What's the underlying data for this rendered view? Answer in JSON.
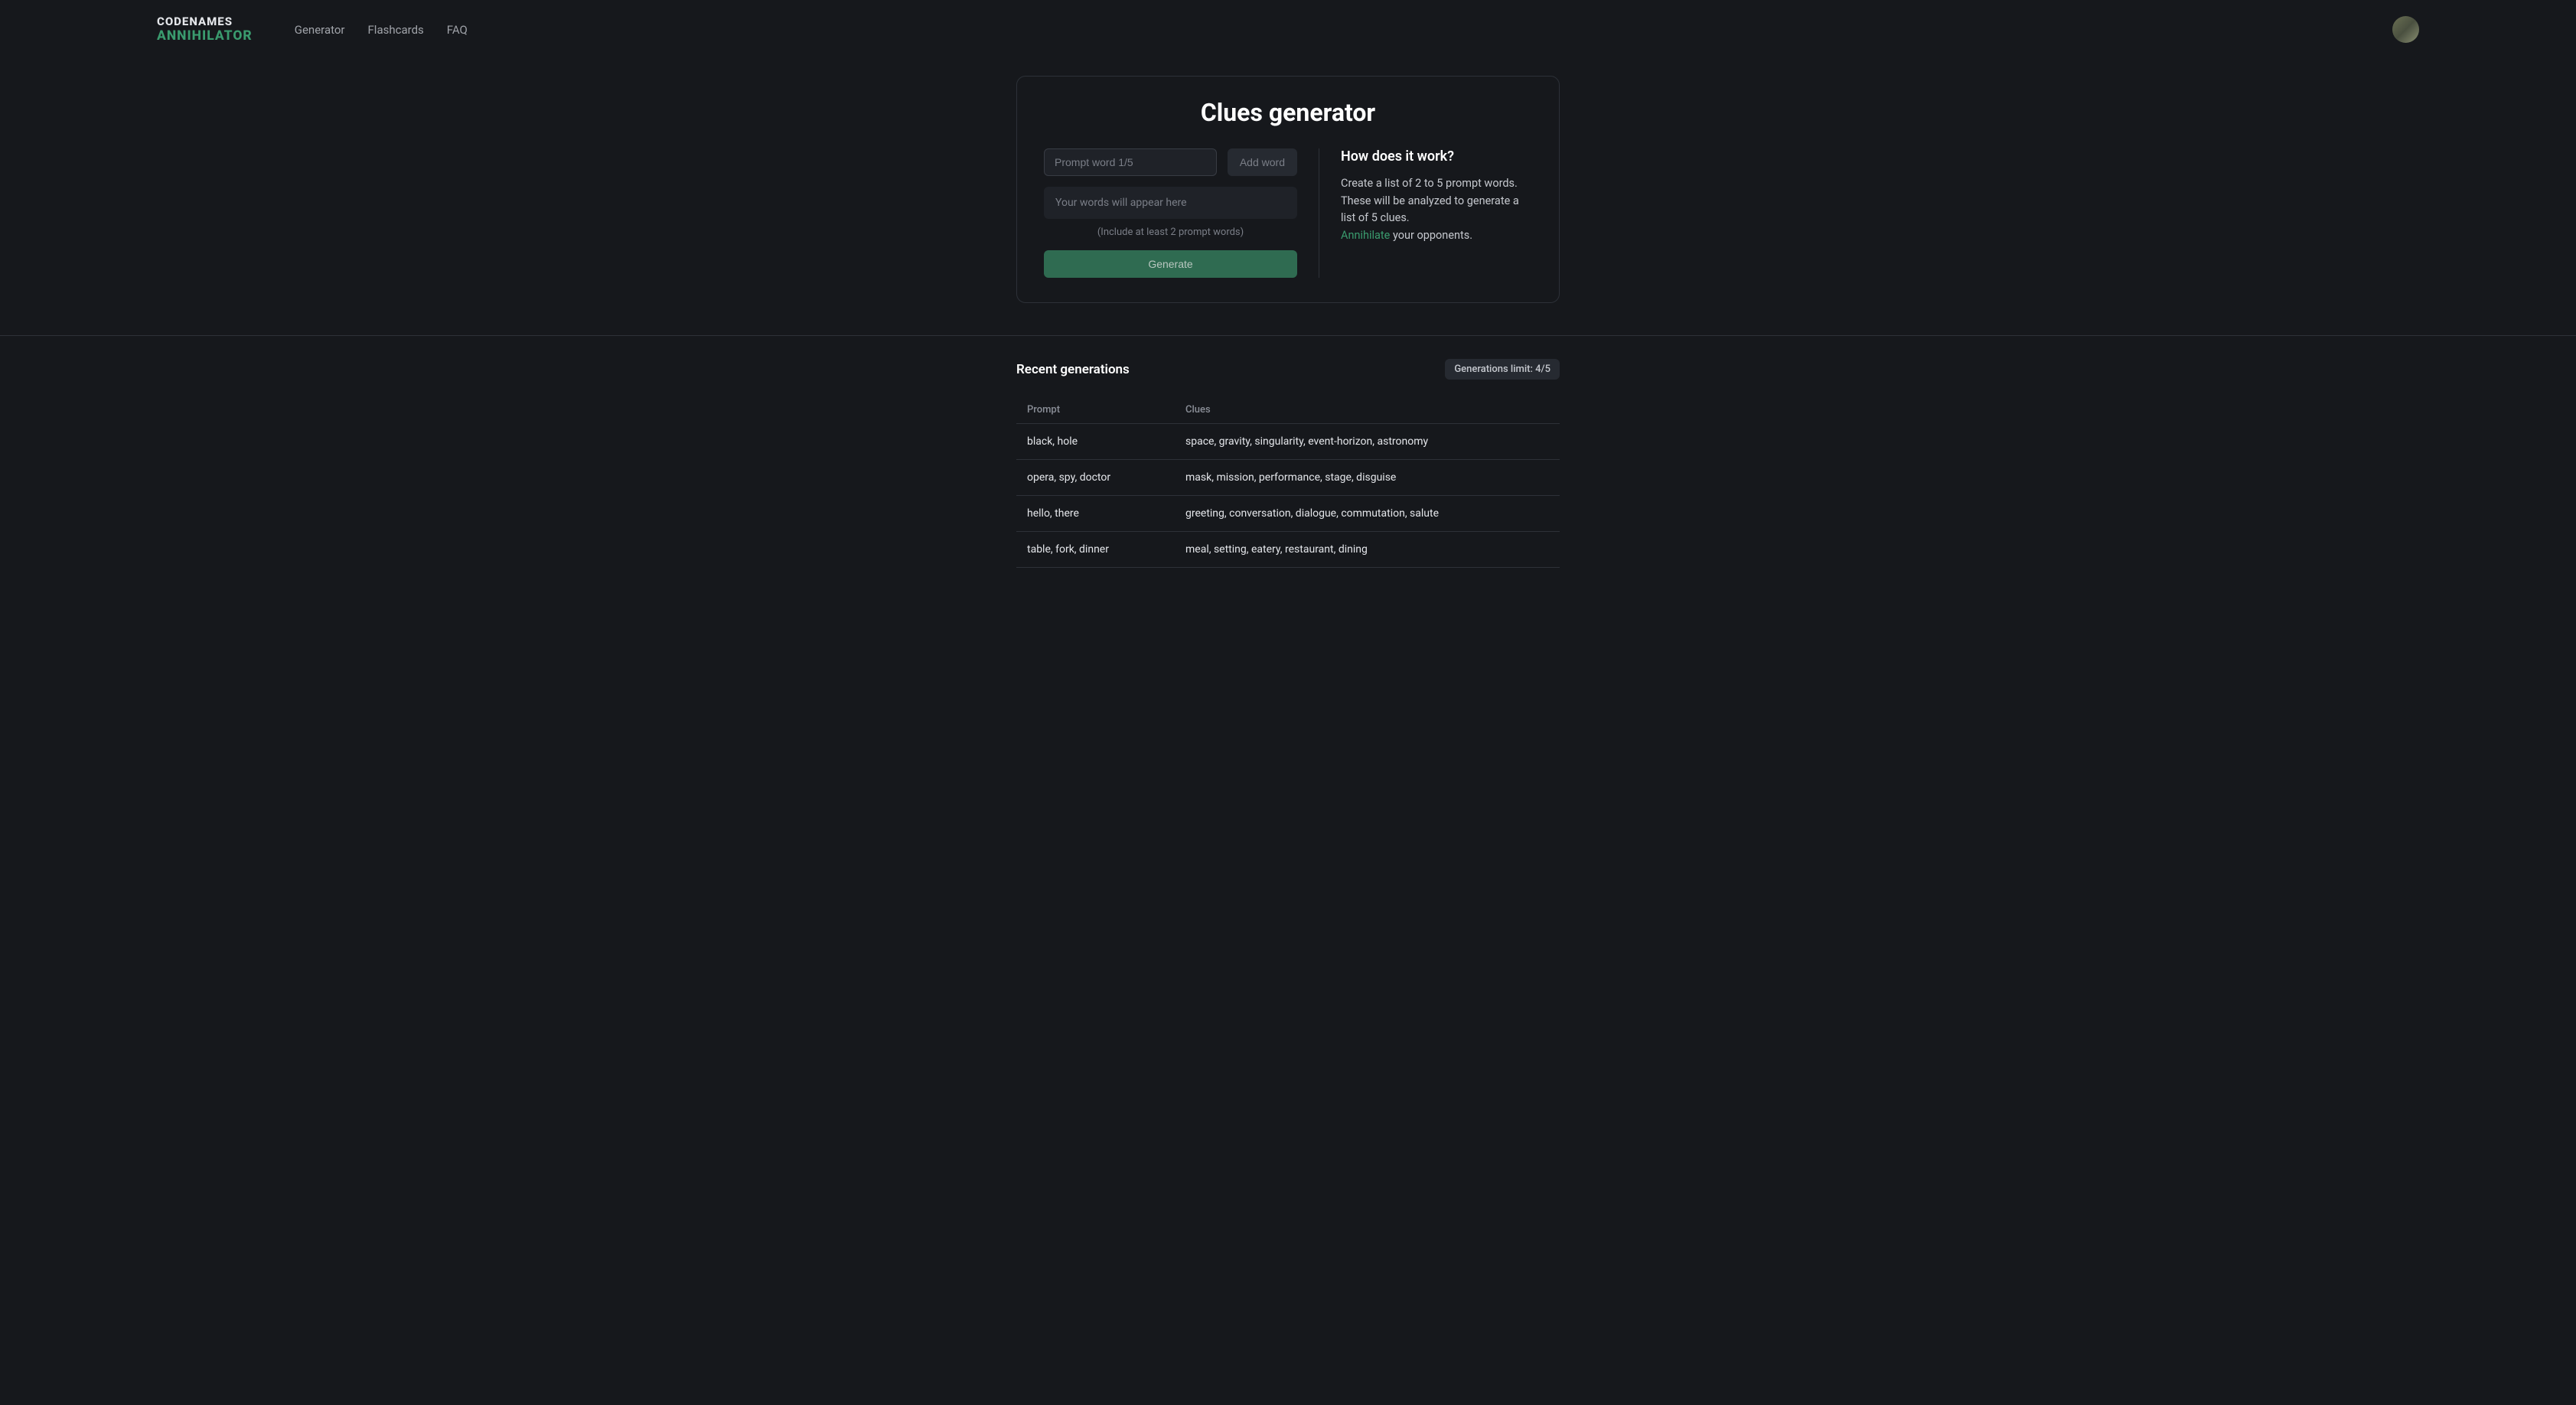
{
  "logo": {
    "line1": "CODENAMES",
    "line2": "ANNIHILATOR"
  },
  "nav": {
    "generator": "Generator",
    "flashcards": "Flashcards",
    "faq": "FAQ"
  },
  "card": {
    "title": "Clues generator",
    "input_placeholder": "Prompt word 1/5",
    "add_word_label": "Add word",
    "words_placeholder": "Your words will appear here",
    "hint": "(Include at least 2 prompt words)",
    "generate_label": "Generate"
  },
  "info": {
    "title": "How does it work?",
    "text_part1": "Create a list of 2 to 5 prompt words. These will be analyzed to generate a list of 5 clues.",
    "highlight": "Annihilate",
    "text_part2": " your opponents."
  },
  "recent": {
    "title": "Recent generations",
    "limit_label": "Generations limit: 4/5",
    "col_prompt": "Prompt",
    "col_clues": "Clues",
    "rows": [
      {
        "prompt": "black, hole",
        "clues": "space, gravity, singularity, event-horizon, astronomy"
      },
      {
        "prompt": "opera, spy, doctor",
        "clues": "mask, mission, performance, stage, disguise"
      },
      {
        "prompt": "hello, there",
        "clues": "greeting, conversation, dialogue, commutation, salute"
      },
      {
        "prompt": "table, fork, dinner",
        "clues": "meal, setting, eatery, restaurant, dining"
      }
    ]
  }
}
